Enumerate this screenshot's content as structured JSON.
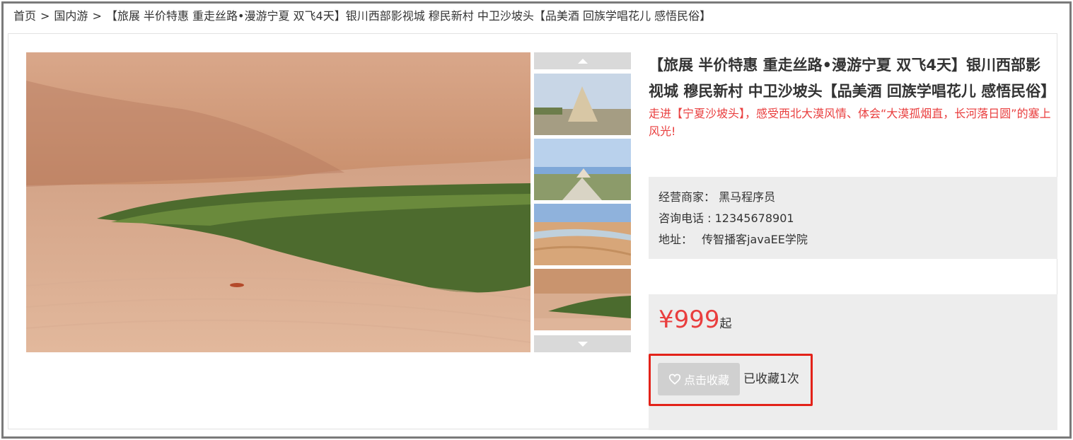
{
  "breadcrumb": {
    "home": "首页",
    "separator": ">",
    "category": "国内游",
    "current": "【旅展 半价特惠 重走丝路•漫游宁夏 双飞4天】银川西部影视城 穆民新村 中卫沙坡头【品美酒 回族学唱花儿 感悟民俗】"
  },
  "product": {
    "title": "【旅展 半价特惠 重走丝路•漫游宁夏 双飞4天】银川西部影视城 穆民新村 中卫沙坡头【品美酒 回族学唱花儿 感悟民俗】",
    "subtitle": "走进【宁夏沙坡头】，感受西北大漠风情、体会“大漠孤烟直，长河落日圆”的塞上风光!",
    "merchant_label": "经营商家：",
    "merchant_value": "黑马程序员",
    "phone_label": "咨询电话 :",
    "phone_value": "12345678901",
    "address_label": "地址：",
    "address_value": "传智播客javaEE学院",
    "price": "¥999",
    "price_suffix": "起",
    "favorite_button": "点击收藏",
    "favorite_count": "已收藏1次"
  },
  "gallery": {
    "thumbnails": [
      "thumb-pagoda-tombs",
      "thumb-pagoda-road",
      "thumb-desert-river",
      "thumb-desert-lake"
    ],
    "icons": {
      "up": "arrow-up-icon",
      "down": "arrow-down-icon",
      "heart": "heart-icon"
    }
  },
  "colors": {
    "accent_red": "#e93e3e",
    "highlight_border": "#e32219",
    "panel_gray": "#ededed",
    "button_gray": "#d0d0d0"
  }
}
